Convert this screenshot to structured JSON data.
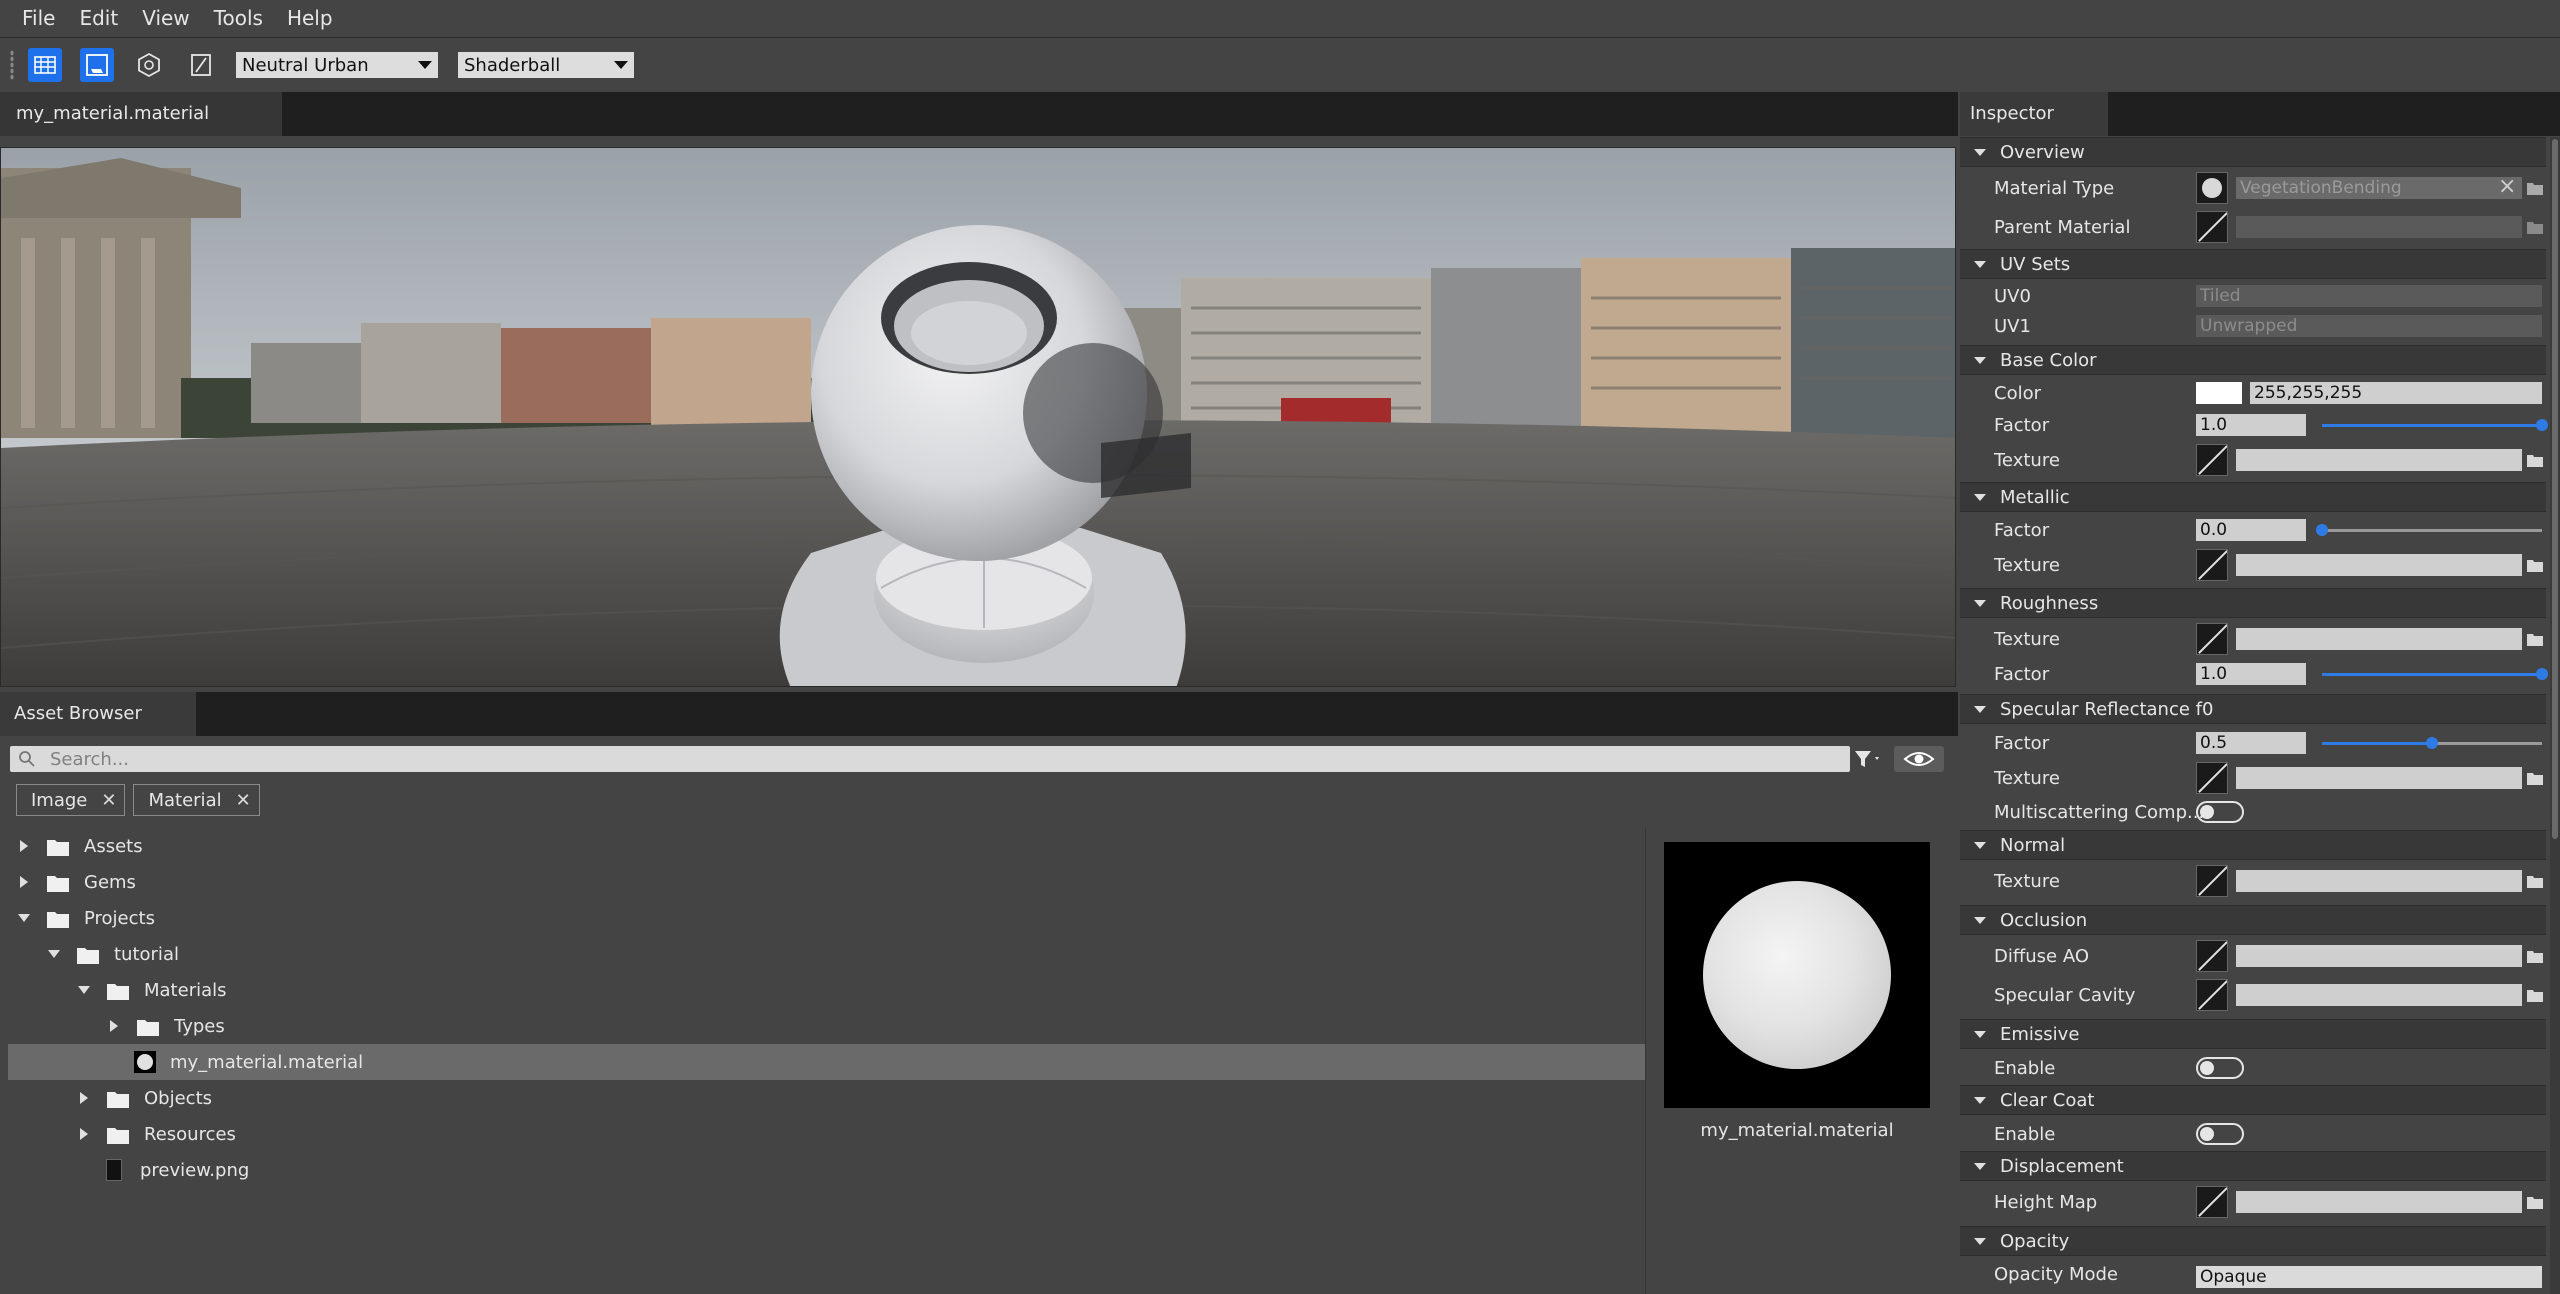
{
  "menubar": {
    "items": [
      "File",
      "Edit",
      "View",
      "Tools",
      "Help"
    ]
  },
  "toolbar": {
    "lighting_preset": "Neutral Urban",
    "model_preset": "Shaderball"
  },
  "viewport": {
    "tab": "my_material.material"
  },
  "asset_browser": {
    "tab": "Asset Browser",
    "search_placeholder": "Search...",
    "filters": [
      "Image",
      "Material"
    ],
    "tree": [
      {
        "label": "Assets"
      },
      {
        "label": "Gems"
      },
      {
        "label": "Projects"
      },
      {
        "label": "tutorial"
      },
      {
        "label": "Materials"
      },
      {
        "label": "Types"
      },
      {
        "label": "my_material.material"
      },
      {
        "label": "Objects"
      },
      {
        "label": "Resources"
      },
      {
        "label": "preview.png"
      }
    ],
    "preview_label": "my_material.material"
  },
  "inspector": {
    "tab": "Inspector",
    "overview": {
      "title": "Overview",
      "material_type_label": "Material Type",
      "material_type_value": "VegetationBending",
      "parent_material_label": "Parent Material"
    },
    "uv_sets": {
      "title": "UV Sets",
      "uv0_label": "UV0",
      "uv0_value": "Tiled",
      "uv1_label": "UV1",
      "uv1_value": "Unwrapped"
    },
    "base_color": {
      "title": "Base Color",
      "color_label": "Color",
      "color_value": "255,255,255",
      "factor_label": "Factor",
      "factor_value": "1.0",
      "factor_level": 1.0,
      "texture_label": "Texture"
    },
    "metallic": {
      "title": "Metallic",
      "factor_label": "Factor",
      "factor_value": "0.0",
      "factor_level": 0.0,
      "texture_label": "Texture"
    },
    "roughness": {
      "title": "Roughness",
      "texture_label": "Texture",
      "factor_label": "Factor",
      "factor_value": "1.0",
      "factor_level": 1.0
    },
    "specular": {
      "title": "Specular Reflectance f0",
      "factor_label": "Factor",
      "factor_value": "0.5",
      "factor_level": 0.5,
      "texture_label": "Texture",
      "multiscatter_label": "Multiscattering Comp..."
    },
    "normal": {
      "title": "Normal",
      "texture_label": "Texture"
    },
    "occlusion": {
      "title": "Occlusion",
      "diffuse_label": "Diffuse AO",
      "specular_label": "Specular Cavity"
    },
    "emissive": {
      "title": "Emissive",
      "enable_label": "Enable"
    },
    "clear_coat": {
      "title": "Clear Coat",
      "enable_label": "Enable"
    },
    "displacement": {
      "title": "Displacement",
      "height_map_label": "Height Map"
    },
    "opacity": {
      "title": "Opacity",
      "mode_label": "Opacity Mode",
      "mode_value": "Opaque"
    }
  },
  "colors": {
    "accent": "#1e70eb",
    "panel": "#444444",
    "tab_strip": "#1f1f1f"
  }
}
